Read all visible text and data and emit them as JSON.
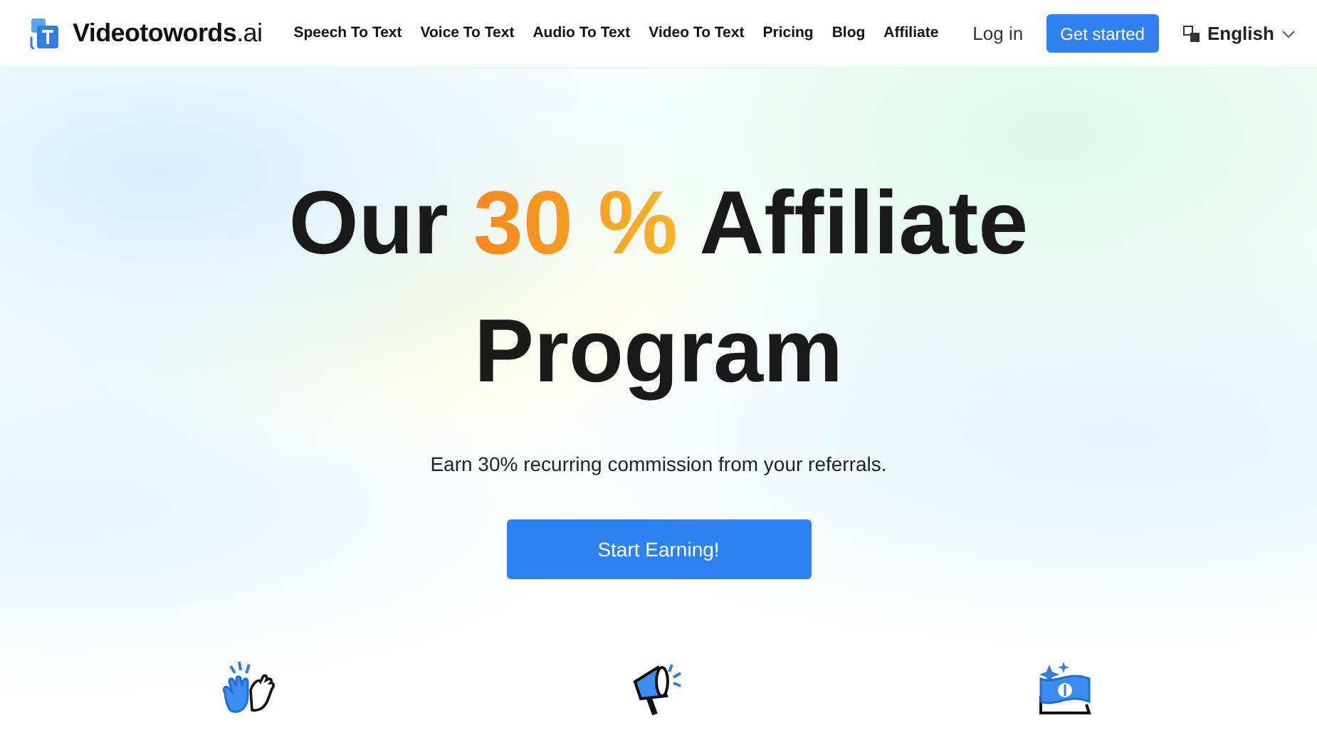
{
  "brand": {
    "name": "Videotowords",
    "suffix": ".ai"
  },
  "nav": [
    {
      "label": "Speech To Text"
    },
    {
      "label": "Voice To Text"
    },
    {
      "label": "Audio To Text"
    },
    {
      "label": "Video To Text"
    },
    {
      "label": "Pricing"
    },
    {
      "label": "Blog"
    },
    {
      "label": "Affiliate"
    }
  ],
  "login": "Log in",
  "cta": "Get started",
  "language": "English",
  "hero": {
    "title": [
      {
        "text": "Our ",
        "kind": "plain"
      },
      {
        "text": "30 %",
        "kind": "highlight"
      },
      {
        "text": " Affiliate Program",
        "kind": "plain"
      }
    ],
    "subtitle": "Earn 30% recurring commission from your referrals.",
    "button": "Start Earning!"
  }
}
